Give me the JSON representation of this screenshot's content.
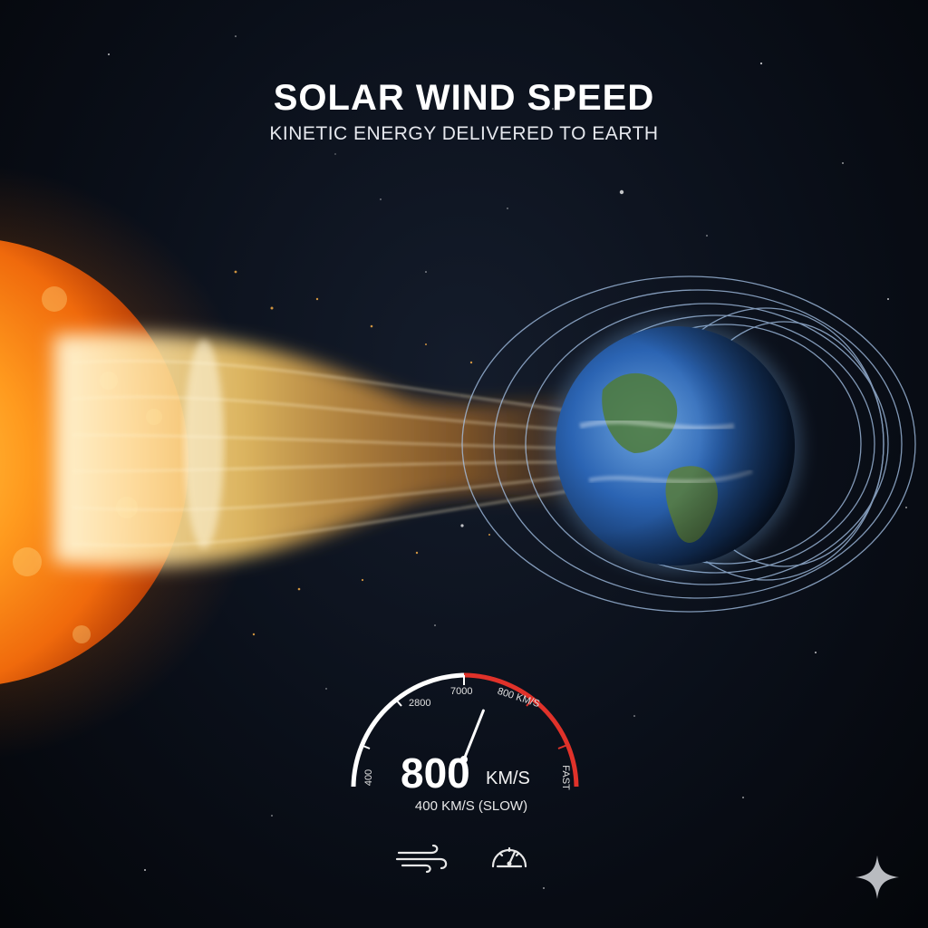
{
  "header": {
    "title": "SOLAR WIND SPEED",
    "subtitle": "KINETIC ENERGY DELIVERED TO EARTH"
  },
  "gauge": {
    "value": "800",
    "unit": "KM/S",
    "caption": "400 KM/S (SLOW)",
    "needle_fraction": 0.62,
    "tick_labels": [
      "400",
      "2800",
      "7000",
      "800 KM/S",
      "FAST"
    ],
    "colors": {
      "normal": "#ffffff",
      "fast": "#e0322a"
    }
  },
  "icons": [
    "wind-icon",
    "speedometer-icon",
    "sparkle-icon"
  ],
  "colors": {
    "sun": "#ff8a1a",
    "stream": "#ffd27a",
    "earth_ocean": "#2b64b3",
    "field_lines": "#a9c7ec"
  }
}
